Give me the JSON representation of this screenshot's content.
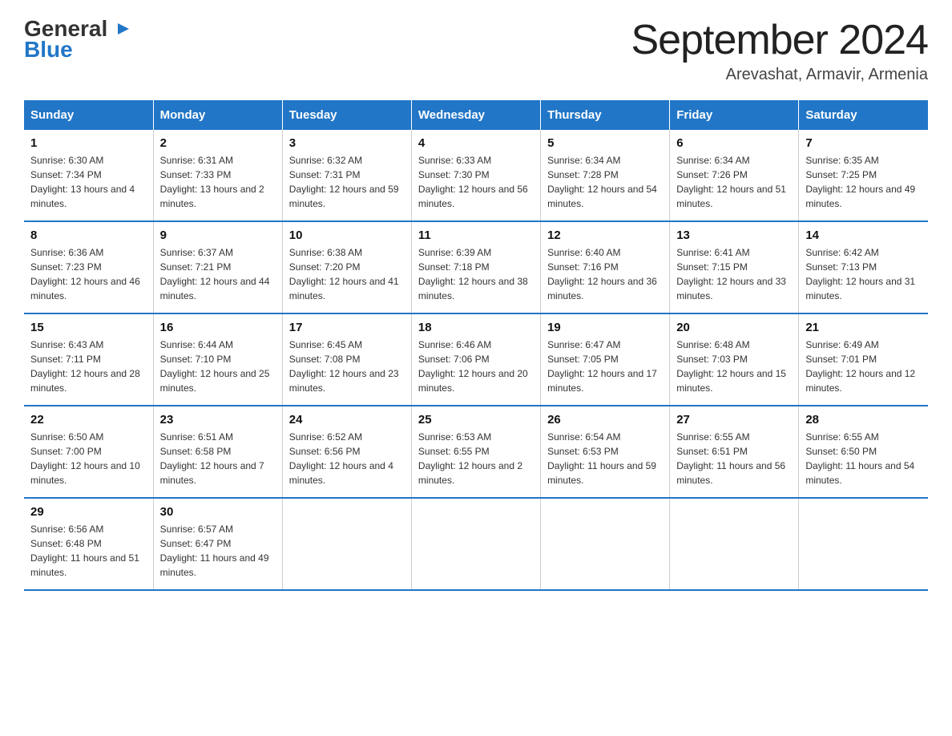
{
  "header": {
    "logo_general": "General",
    "logo_blue": "Blue",
    "month_title": "September 2024",
    "location": "Arevashat, Armavir, Armenia"
  },
  "weekdays": [
    "Sunday",
    "Monday",
    "Tuesday",
    "Wednesday",
    "Thursday",
    "Friday",
    "Saturday"
  ],
  "weeks": [
    [
      {
        "day": "1",
        "sunrise": "6:30 AM",
        "sunset": "7:34 PM",
        "daylight": "13 hours and 4 minutes."
      },
      {
        "day": "2",
        "sunrise": "6:31 AM",
        "sunset": "7:33 PM",
        "daylight": "13 hours and 2 minutes."
      },
      {
        "day": "3",
        "sunrise": "6:32 AM",
        "sunset": "7:31 PM",
        "daylight": "12 hours and 59 minutes."
      },
      {
        "day": "4",
        "sunrise": "6:33 AM",
        "sunset": "7:30 PM",
        "daylight": "12 hours and 56 minutes."
      },
      {
        "day": "5",
        "sunrise": "6:34 AM",
        "sunset": "7:28 PM",
        "daylight": "12 hours and 54 minutes."
      },
      {
        "day": "6",
        "sunrise": "6:34 AM",
        "sunset": "7:26 PM",
        "daylight": "12 hours and 51 minutes."
      },
      {
        "day": "7",
        "sunrise": "6:35 AM",
        "sunset": "7:25 PM",
        "daylight": "12 hours and 49 minutes."
      }
    ],
    [
      {
        "day": "8",
        "sunrise": "6:36 AM",
        "sunset": "7:23 PM",
        "daylight": "12 hours and 46 minutes."
      },
      {
        "day": "9",
        "sunrise": "6:37 AM",
        "sunset": "7:21 PM",
        "daylight": "12 hours and 44 minutes."
      },
      {
        "day": "10",
        "sunrise": "6:38 AM",
        "sunset": "7:20 PM",
        "daylight": "12 hours and 41 minutes."
      },
      {
        "day": "11",
        "sunrise": "6:39 AM",
        "sunset": "7:18 PM",
        "daylight": "12 hours and 38 minutes."
      },
      {
        "day": "12",
        "sunrise": "6:40 AM",
        "sunset": "7:16 PM",
        "daylight": "12 hours and 36 minutes."
      },
      {
        "day": "13",
        "sunrise": "6:41 AM",
        "sunset": "7:15 PM",
        "daylight": "12 hours and 33 minutes."
      },
      {
        "day": "14",
        "sunrise": "6:42 AM",
        "sunset": "7:13 PM",
        "daylight": "12 hours and 31 minutes."
      }
    ],
    [
      {
        "day": "15",
        "sunrise": "6:43 AM",
        "sunset": "7:11 PM",
        "daylight": "12 hours and 28 minutes."
      },
      {
        "day": "16",
        "sunrise": "6:44 AM",
        "sunset": "7:10 PM",
        "daylight": "12 hours and 25 minutes."
      },
      {
        "day": "17",
        "sunrise": "6:45 AM",
        "sunset": "7:08 PM",
        "daylight": "12 hours and 23 minutes."
      },
      {
        "day": "18",
        "sunrise": "6:46 AM",
        "sunset": "7:06 PM",
        "daylight": "12 hours and 20 minutes."
      },
      {
        "day": "19",
        "sunrise": "6:47 AM",
        "sunset": "7:05 PM",
        "daylight": "12 hours and 17 minutes."
      },
      {
        "day": "20",
        "sunrise": "6:48 AM",
        "sunset": "7:03 PM",
        "daylight": "12 hours and 15 minutes."
      },
      {
        "day": "21",
        "sunrise": "6:49 AM",
        "sunset": "7:01 PM",
        "daylight": "12 hours and 12 minutes."
      }
    ],
    [
      {
        "day": "22",
        "sunrise": "6:50 AM",
        "sunset": "7:00 PM",
        "daylight": "12 hours and 10 minutes."
      },
      {
        "day": "23",
        "sunrise": "6:51 AM",
        "sunset": "6:58 PM",
        "daylight": "12 hours and 7 minutes."
      },
      {
        "day": "24",
        "sunrise": "6:52 AM",
        "sunset": "6:56 PM",
        "daylight": "12 hours and 4 minutes."
      },
      {
        "day": "25",
        "sunrise": "6:53 AM",
        "sunset": "6:55 PM",
        "daylight": "12 hours and 2 minutes."
      },
      {
        "day": "26",
        "sunrise": "6:54 AM",
        "sunset": "6:53 PM",
        "daylight": "11 hours and 59 minutes."
      },
      {
        "day": "27",
        "sunrise": "6:55 AM",
        "sunset": "6:51 PM",
        "daylight": "11 hours and 56 minutes."
      },
      {
        "day": "28",
        "sunrise": "6:55 AM",
        "sunset": "6:50 PM",
        "daylight": "11 hours and 54 minutes."
      }
    ],
    [
      {
        "day": "29",
        "sunrise": "6:56 AM",
        "sunset": "6:48 PM",
        "daylight": "11 hours and 51 minutes."
      },
      {
        "day": "30",
        "sunrise": "6:57 AM",
        "sunset": "6:47 PM",
        "daylight": "11 hours and 49 minutes."
      },
      {
        "day": "",
        "sunrise": "",
        "sunset": "",
        "daylight": ""
      },
      {
        "day": "",
        "sunrise": "",
        "sunset": "",
        "daylight": ""
      },
      {
        "day": "",
        "sunrise": "",
        "sunset": "",
        "daylight": ""
      },
      {
        "day": "",
        "sunrise": "",
        "sunset": "",
        "daylight": ""
      },
      {
        "day": "",
        "sunrise": "",
        "sunset": "",
        "daylight": ""
      }
    ]
  ]
}
